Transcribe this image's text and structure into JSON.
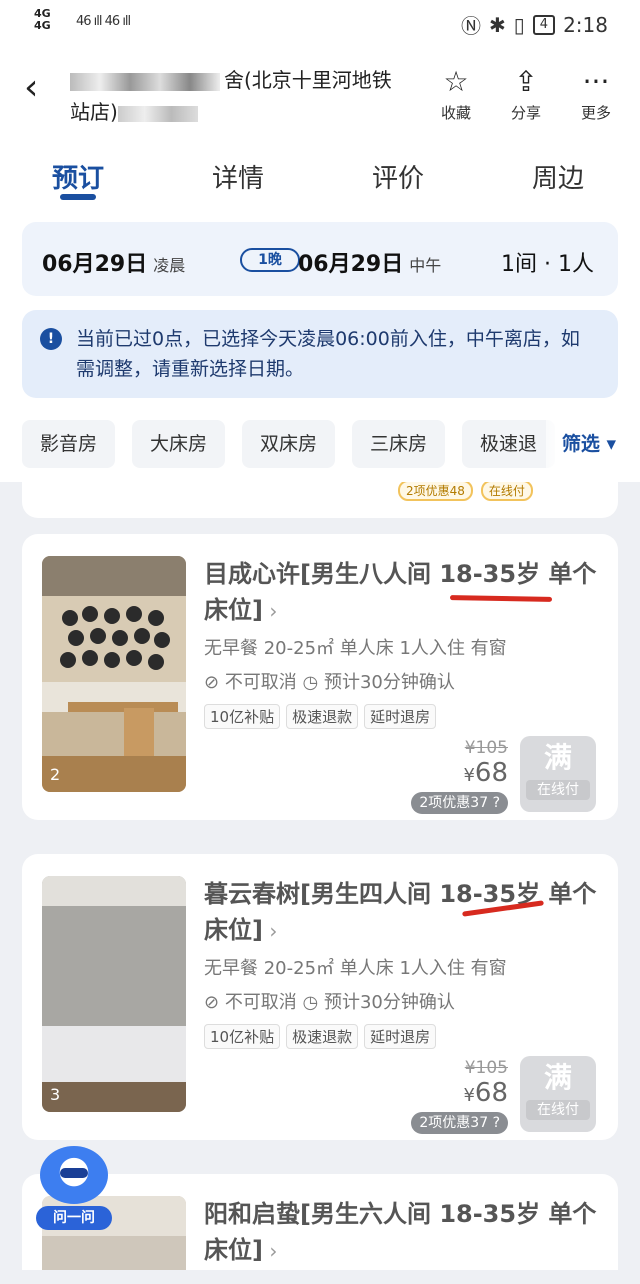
{
  "status_bar": {
    "left_net": "4G",
    "signal": "46 ıll 46 ıll",
    "battery": "4",
    "time": "2:18"
  },
  "header": {
    "title_line1": "舍(北京十里河地铁",
    "title_line2": "站店)",
    "actions": [
      {
        "label": "收藏",
        "icon": "star-icon"
      },
      {
        "label": "分享",
        "icon": "share-icon"
      },
      {
        "label": "更多",
        "icon": "more-icon"
      }
    ]
  },
  "tabs": [
    "预订",
    "详情",
    "评价",
    "周边"
  ],
  "active_tab": 0,
  "date_bar": {
    "checkin_date": "06月29日",
    "checkin_time": "凌晨",
    "nights": "1晚",
    "checkout_date": "06月29日",
    "checkout_time": "中午",
    "rooms_people": "1间 · 1人"
  },
  "notice": "当前已过0点，已选择今天凌晨06:00前入住，中午离店，如需调整，请重新选择日期。",
  "filters": [
    "影音房",
    "大床房",
    "双床房",
    "三床房",
    "极速退"
  ],
  "filter_button": "筛选 ▾",
  "prev_card_tags": [
    "2项优惠48",
    "在线付"
  ],
  "rooms": [
    {
      "name": "目成心许[男生八人间 18-35岁 单个床位]",
      "meta": "无早餐  20-25㎡  单人床  1人入住  有窗",
      "policy_cancel": "不可取消",
      "policy_confirm": "预计30分钟确认",
      "tags": [
        "10亿补贴",
        "极速退款",
        "延时退房"
      ],
      "price_old": "¥105",
      "price_now": "68",
      "price_currency": "¥",
      "discount": "2项优惠37",
      "btn_main": "满",
      "btn_sub": "在线付",
      "photo_count": "2"
    },
    {
      "name": "暮云春树[男生四人间 18-35岁 单个床位]",
      "meta": "无早餐  20-25㎡  单人床  1人入住  有窗",
      "policy_cancel": "不可取消",
      "policy_confirm": "预计30分钟确认",
      "tags": [
        "10亿补贴",
        "极速退款",
        "延时退房"
      ],
      "price_old": "¥105",
      "price_now": "68",
      "price_currency": "¥",
      "discount": "2项优惠37",
      "btn_main": "满",
      "btn_sub": "在线付",
      "photo_count": "3"
    },
    {
      "name": "阳和启蛰[男生六人间 18-35岁 单个床位]"
    }
  ],
  "assistant_label": "问一问",
  "colors": {
    "brand_blue": "#1a4fa0",
    "highlight_red": "#d72a1f"
  }
}
